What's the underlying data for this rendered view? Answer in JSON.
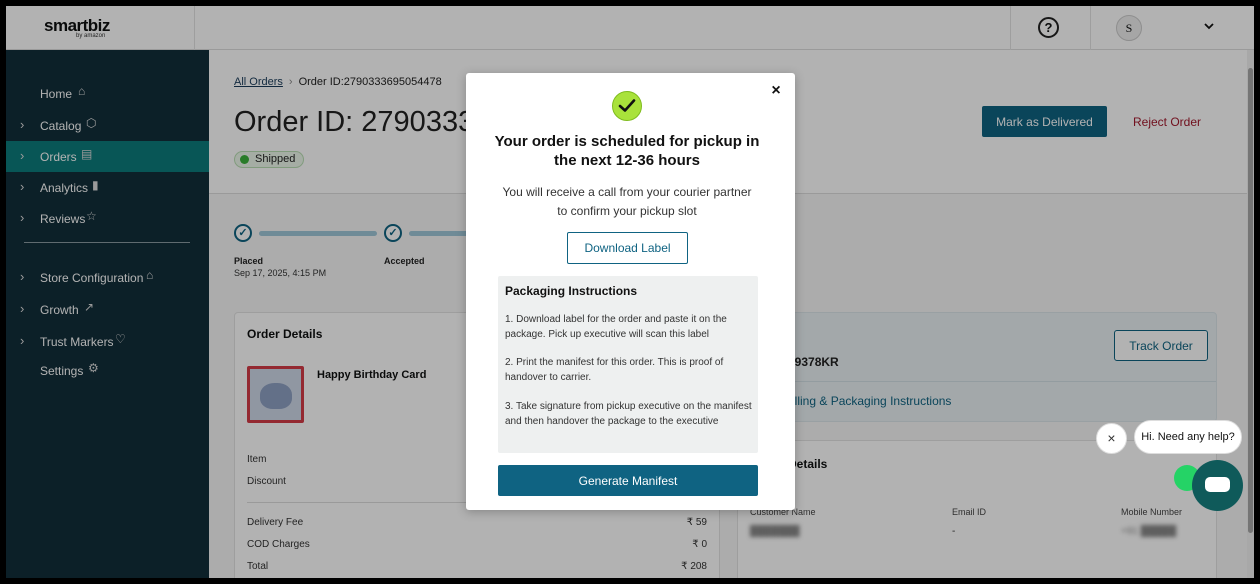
{
  "header": {
    "logo": "smartbiz",
    "logo_sub": "by amazon",
    "help_icon": "?",
    "avatar_initial": "S",
    "user_menu_icon": "chevron-down-icon"
  },
  "sidebar": {
    "items": [
      {
        "label": "Home",
        "icon": "home-icon",
        "glyph": "⌂"
      },
      {
        "label": "Catalog",
        "icon": "cube-icon",
        "glyph": "⬡"
      },
      {
        "label": "Orders",
        "icon": "clipboard-icon",
        "glyph": "▤"
      },
      {
        "label": "Analytics",
        "icon": "bar-chart-icon",
        "glyph": "▮"
      },
      {
        "label": "Reviews",
        "icon": "star-icon",
        "glyph": "☆"
      },
      {
        "label": "Store Configuration",
        "icon": "store-icon",
        "glyph": "⌂"
      },
      {
        "label": "Growth",
        "icon": "trend-up-icon",
        "glyph": "↗"
      },
      {
        "label": "Trust Markers",
        "icon": "shield-heart-icon",
        "glyph": "♡"
      },
      {
        "label": "Settings",
        "icon": "gear-icon",
        "glyph": "⚙"
      }
    ],
    "chevron": "›",
    "active": "Orders"
  },
  "main": {
    "breadcrumb": {
      "root": "All Orders",
      "sep": "›",
      "current": "Order ID:2790333695054478"
    },
    "title": "Order ID: 2790333",
    "status": "Shipped",
    "mark_delivered": "Mark as Delivered",
    "reject_order": "Reject Order",
    "steps": [
      {
        "label": "Placed",
        "date": "Sep 17, 2025, 4:15 PM"
      },
      {
        "label": "Accepted",
        "date": ""
      }
    ],
    "order_details": {
      "title": "Order Details",
      "product_name": "Happy Birthday Card",
      "rows": [
        {
          "label": "Item",
          "value": ""
        },
        {
          "label": "Discount",
          "value": ""
        },
        {
          "label": "Delivery Fee",
          "value": "₹ 59"
        },
        {
          "label": "COD Charges",
          "value": "₹ 0"
        },
        {
          "label": "Total",
          "value": "₹ 208"
        }
      ]
    },
    "shipping": {
      "tracking_partial": "49378KR",
      "track_order": "Track Order",
      "labelling_link": "elling & Packaging Instructions"
    },
    "customer": {
      "title_partial": "Details",
      "columns": [
        {
          "label": "Customer Name",
          "value": "███████"
        },
        {
          "label": "Email ID",
          "value": "-"
        },
        {
          "label": "Mobile Number",
          "value": "+91 █████"
        }
      ]
    }
  },
  "modal": {
    "close": "×",
    "title": "Your order is scheduled for pickup in the next 12-36 hours",
    "subtitle": "You will receive a call from your courier partner to confirm your pickup slot",
    "download_label": "Download Label",
    "instructions_title": "Packaging Instructions",
    "instructions": [
      "1. Download label for the order and paste it on the package. Pick up executive will scan this label",
      "2. Print the manifest for this order. This is proof of handover to carrier.",
      "3. Take signature from pickup executive on the manifest and then handover the package to the executive"
    ],
    "generate_manifest": "Generate Manifest"
  },
  "chat": {
    "close": "×",
    "bubble": "Hi. Need any help?"
  },
  "colors": {
    "primary": "#0f6382",
    "sidebar_bg": "#122e3a",
    "sidebar_active": "#0c7b7b",
    "reject": "#a3182c",
    "success": "#3bb23b"
  }
}
